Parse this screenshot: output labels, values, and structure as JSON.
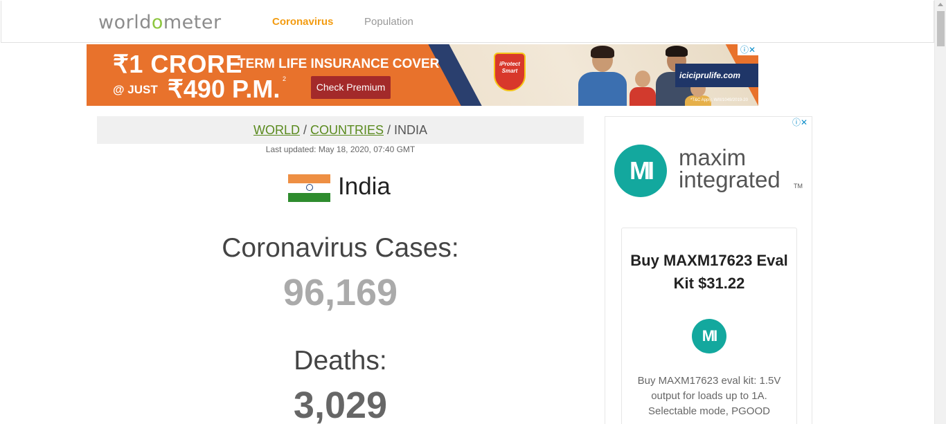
{
  "nav": {
    "logo_pre": "worldometer",
    "links": [
      "Coronavirus",
      "Population"
    ]
  },
  "top_ad": {
    "line1_big": "₹1 CRORE",
    "line1_small": "TERM LIFE INSURANCE COVER",
    "line2_prefix": "@ JUST",
    "line2_price": "₹490 P.M.",
    "superscript": "2",
    "cta": "Check Premium",
    "shield_text": "iProtect Smart",
    "url": "iciciprulife.com",
    "tc": "*T&C Apply. W/II/1049/2019-20",
    "adchoice": "ⓘ✕"
  },
  "breadcrumb": {
    "world": "WORLD",
    "sep1": " / ",
    "countries": "COUNTRIES",
    "sep2": " / ",
    "current": "INDIA"
  },
  "last_updated": "Last updated: May 18, 2020, 07:40 GMT",
  "country": {
    "name": "India",
    "flag_icon": "india-flag-icon"
  },
  "stats": {
    "cases_label": "Coronavirus Cases:",
    "cases_value": "96,169",
    "deaths_label": "Deaths:",
    "deaths_value": "3,029"
  },
  "side_ad": {
    "adchoice": "ⓘ✕",
    "brand_line1": "maxim",
    "brand_line2": "integrated",
    "tm": "TM",
    "logo_glyph": "MI",
    "title": "Buy MAXM17623 Eval Kit $31.22",
    "description": "Buy MAXM17623 eval kit: 1.5V output for loads up to 1A. Selectable mode, PGOOD"
  },
  "colors": {
    "accent_orange": "#f39c12",
    "link_green": "#5a8a1e",
    "maxim_teal": "#13a89e",
    "banner_orange": "#e8722c"
  }
}
